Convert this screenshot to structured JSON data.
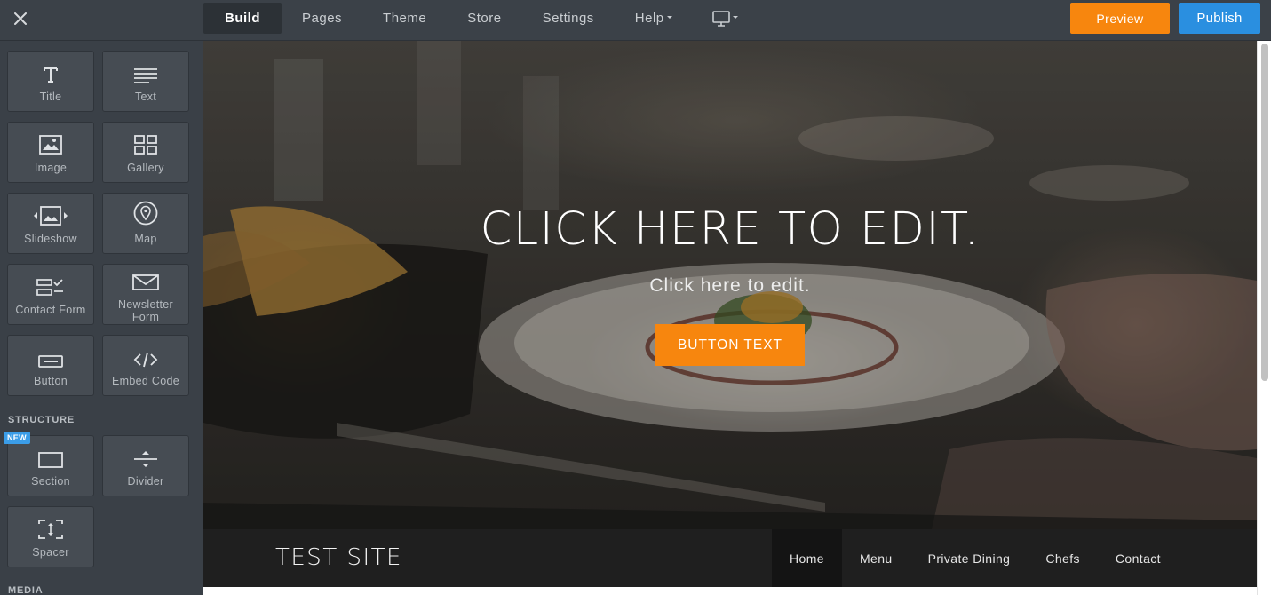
{
  "topbar": {
    "nav": [
      {
        "label": "Build",
        "active": true
      },
      {
        "label": "Pages"
      },
      {
        "label": "Theme"
      },
      {
        "label": "Store"
      },
      {
        "label": "Settings"
      },
      {
        "label": "Help"
      }
    ],
    "device_icon": "desktop-monitor-icon",
    "preview_label": "Preview",
    "publish_label": "Publish",
    "colors": {
      "preview": "#f7860e",
      "publish": "#2a8fe0"
    }
  },
  "sidebar": {
    "elements": [
      {
        "label": "Title",
        "icon": "title-T-icon"
      },
      {
        "label": "Text",
        "icon": "text-lines-icon"
      },
      {
        "label": "Image",
        "icon": "image-icon"
      },
      {
        "label": "Gallery",
        "icon": "gallery-grid-icon"
      },
      {
        "label": "Slideshow",
        "icon": "slideshow-icon"
      },
      {
        "label": "Map",
        "icon": "map-pin-icon"
      },
      {
        "label": "Contact Form",
        "icon": "contact-form-icon"
      },
      {
        "label": "Newsletter Form",
        "icon": "envelope-icon"
      },
      {
        "label": "Button",
        "icon": "button-icon"
      },
      {
        "label": "Embed Code",
        "icon": "code-icon"
      }
    ],
    "structure_heading": "STRUCTURE",
    "new_badge": "NEW",
    "structure": [
      {
        "label": "Section",
        "icon": "section-icon"
      },
      {
        "label": "Divider",
        "icon": "divider-icon"
      },
      {
        "label": "Spacer",
        "icon": "spacer-icon"
      }
    ],
    "media_heading": "MEDIA"
  },
  "hero": {
    "title": "CLICK HERE TO EDIT.",
    "subtitle": "Click here to edit.",
    "button": "BUTTON TEXT",
    "button_color": "#f7860e"
  },
  "site": {
    "title": "TEST SITE",
    "nav": [
      "Home",
      "Menu",
      "Private Dining",
      "Chefs",
      "Contact"
    ],
    "active_nav": "Home"
  }
}
